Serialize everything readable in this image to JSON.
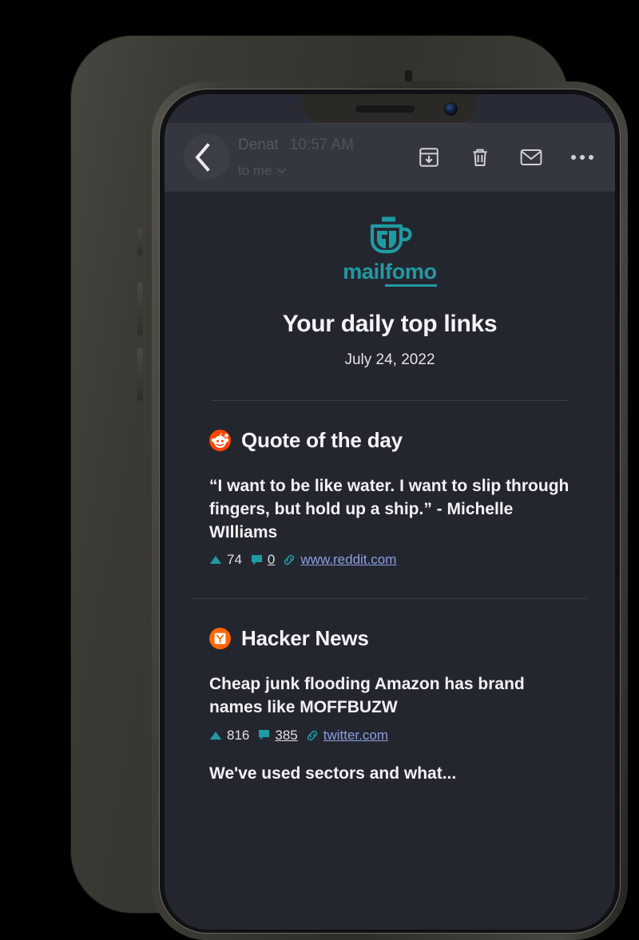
{
  "device": {
    "name": "iphone-mockup",
    "notch": "present"
  },
  "toolbar": {
    "back_label": "Back",
    "sender_name": "Denat",
    "sender_time": "10:57 AM",
    "recipient": "to me",
    "actions": [
      {
        "name": "archive-button",
        "label": "Archive"
      },
      {
        "name": "delete-button",
        "label": "Delete"
      },
      {
        "name": "mark-unread-button",
        "label": "Mark as unread"
      },
      {
        "name": "more-options-button",
        "label": "More options"
      }
    ]
  },
  "email": {
    "brand": {
      "logo_icon": "coffee-cup-icon",
      "wordmark_part1": "mail",
      "wordmark_part2": "fomo",
      "brand_color": "#1f9aa3"
    },
    "headline": "Your daily top links",
    "date": "July 24, 2022",
    "sections": [
      {
        "id": "quote-of-the-day",
        "icon": "reddit-icon",
        "icon_color": "#ff4500",
        "title": "Quote of the day",
        "items": [
          {
            "title": "“I want to be like water. I want to slip through fingers, but hold up a ship.” - Michelle WIlliams",
            "upvotes": "74",
            "comments": "0",
            "source": "www.reddit.com"
          }
        ]
      },
      {
        "id": "hacker-news",
        "icon": "hacker-news-icon",
        "icon_color": "#ff6600",
        "title": "Hacker News",
        "items": [
          {
            "title": "Cheap junk flooding Amazon has brand names like MOFFBUZW",
            "upvotes": "816",
            "comments": "385",
            "source": "twitter.com"
          },
          {
            "title": "We've used sectors and what...",
            "upvotes": "",
            "comments": "",
            "source": ""
          }
        ]
      }
    ]
  }
}
